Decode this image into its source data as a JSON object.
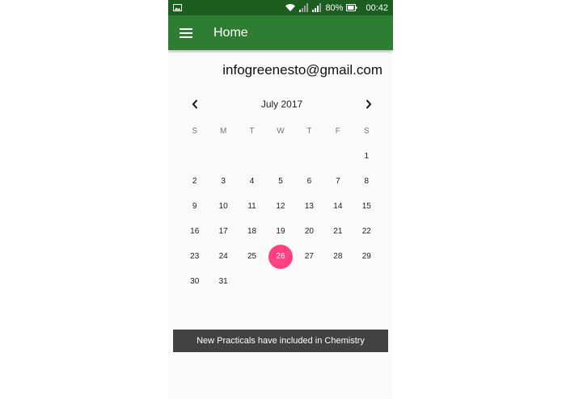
{
  "status_bar": {
    "battery": "80%",
    "time": "00:42",
    "icons": [
      "image-icon",
      "wifi-icon",
      "signal-icon",
      "signal-icon",
      "battery-icon"
    ]
  },
  "app_bar": {
    "title": "Home",
    "menu_icon": "hamburger-menu-icon"
  },
  "user": {
    "email": "infogreenesto@gmail.com"
  },
  "calendar": {
    "month_label": "July 2017",
    "prev_icon": "chevron-left-icon",
    "next_icon": "chevron-right-icon",
    "weekdays": [
      "S",
      "M",
      "T",
      "W",
      "T",
      "F",
      "S"
    ],
    "first_weekday_index": 6,
    "days": [
      "1",
      "2",
      "3",
      "4",
      "5",
      "6",
      "7",
      "8",
      "9",
      "10",
      "11",
      "12",
      "13",
      "14",
      "15",
      "16",
      "17",
      "18",
      "19",
      "20",
      "21",
      "22",
      "23",
      "24",
      "25",
      "26",
      "27",
      "28",
      "29",
      "30",
      "31"
    ],
    "selected_day": "26"
  },
  "snackbar": {
    "message": "New Practicals have included in Chemistry"
  },
  "colors": {
    "status_bar": "#1b5e20",
    "app_bar": "#2e7d32",
    "selected_day": "#ff4081",
    "snackbar": "#424242"
  }
}
